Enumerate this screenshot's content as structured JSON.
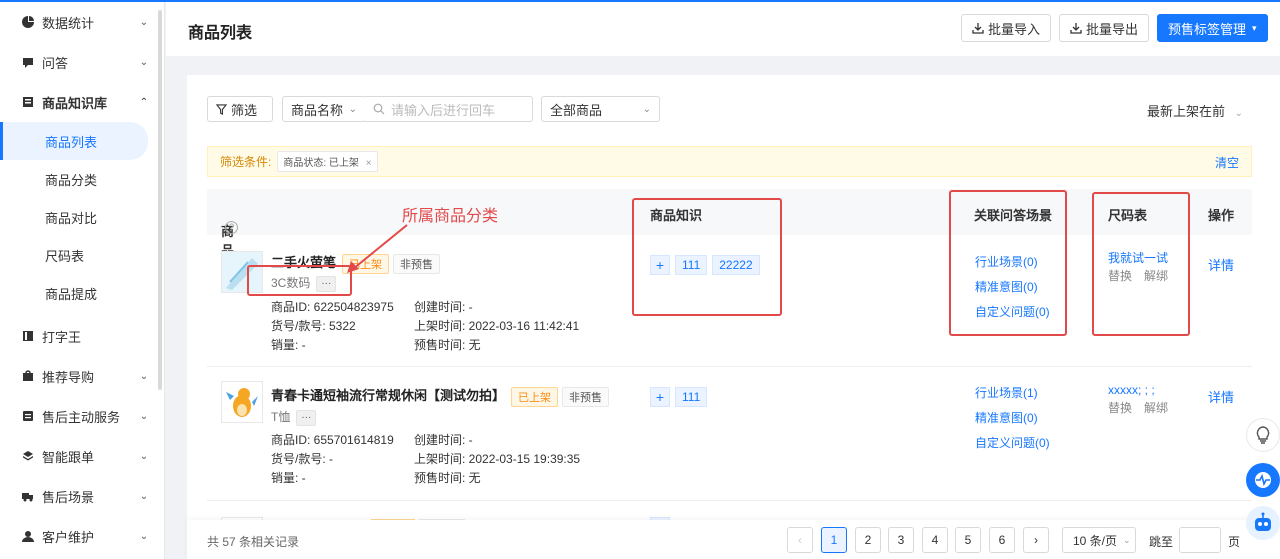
{
  "sidebar": {
    "items": [
      {
        "label": "数据统计",
        "icon": "pie-chart-icon",
        "chev": "⌄"
      },
      {
        "label": "问答",
        "icon": "chat-icon",
        "chev": "⌄"
      },
      {
        "label": "商品知识库",
        "icon": "book-icon",
        "chev": "⌃"
      }
    ],
    "sub": [
      "商品列表",
      "商品分类",
      "商品对比",
      "尺码表",
      "商品提成"
    ],
    "after": [
      {
        "label": "打字王",
        "icon": "keyboard-icon",
        "chev": ""
      },
      {
        "label": "推荐导购",
        "icon": "bag-icon",
        "chev": "⌄"
      },
      {
        "label": "售后主动服务",
        "icon": "service-icon",
        "chev": "⌄"
      },
      {
        "label": "智能跟单",
        "icon": "layers-icon",
        "chev": "⌄"
      },
      {
        "label": "售后场景",
        "icon": "truck-icon",
        "chev": "⌄"
      },
      {
        "label": "客户维护",
        "icon": "user-icon",
        "chev": "⌄"
      }
    ]
  },
  "header": {
    "title": "商品列表",
    "import_label": "批量导入",
    "export_label": "批量导出",
    "presale_label": "预售标签管理"
  },
  "toolbar": {
    "filter_label": "筛选",
    "field_label": "商品名称",
    "search_placeholder": "请输入后进行回车",
    "scope_label": "全部商品",
    "sort_label": "最新上架在前"
  },
  "filterbar": {
    "label": "筛选条件:",
    "chip": "商品状态: 已上架",
    "clear": "清空"
  },
  "table": {
    "headers": {
      "product": "商品",
      "knowledge": "商品知识",
      "scenes": "关联问答场景",
      "size": "尺码表",
      "action": "操作"
    },
    "rows": [
      {
        "name": "二手火萤笔",
        "status": "已上架",
        "presale": "非预售",
        "category": "3C数码",
        "more": "···",
        "product_id": "商品ID: 622504823975",
        "sku": "货号/款号: 5322",
        "sales": "销量: -",
        "created": "创建时间: -",
        "listed": "上架时间: 2022-03-16 11:42:41",
        "presale_time": "预售时间: 无",
        "knowledge": [
          "111",
          "22222"
        ],
        "scenes": [
          "行业场景(0)",
          "精准意图(0)",
          "自定义问题(0)"
        ],
        "size_value": "我就试一试",
        "size_ops": [
          "替换",
          "解绑"
        ],
        "action": "详情"
      },
      {
        "name": "青春卡通短袖流行常规休闲【测试勿拍】",
        "status": "已上架",
        "presale": "非预售",
        "category": "T恤",
        "more": "···",
        "product_id": "商品ID: 655701614819",
        "sku": "货号/款号: -",
        "sales": "销量: -",
        "created": "创建时间: -",
        "listed": "上架时间: 2022-03-15 19:39:35",
        "presale_time": "预售时间: 无",
        "knowledge": [
          "111"
        ],
        "scenes": [
          "行业场景(1)",
          "精准意图(0)",
          "自定义问题(0)"
        ],
        "size_value": "xxxxx; ; ;",
        "size_ops": [
          "替换",
          "解绑"
        ],
        "action": "详情"
      }
    ]
  },
  "annotation": {
    "label": "所属商品分类"
  },
  "pagination": {
    "total": "共 57 条相关记录",
    "pages": [
      "1",
      "2",
      "3",
      "4",
      "5",
      "6"
    ],
    "current": "1",
    "page_size": "10 条/页",
    "jump_label": "跳至",
    "page_unit": "页"
  },
  "colors": {
    "accent": "#1677ff",
    "annotation": "#e24a4a",
    "listed_tag": "#fa8c16"
  }
}
